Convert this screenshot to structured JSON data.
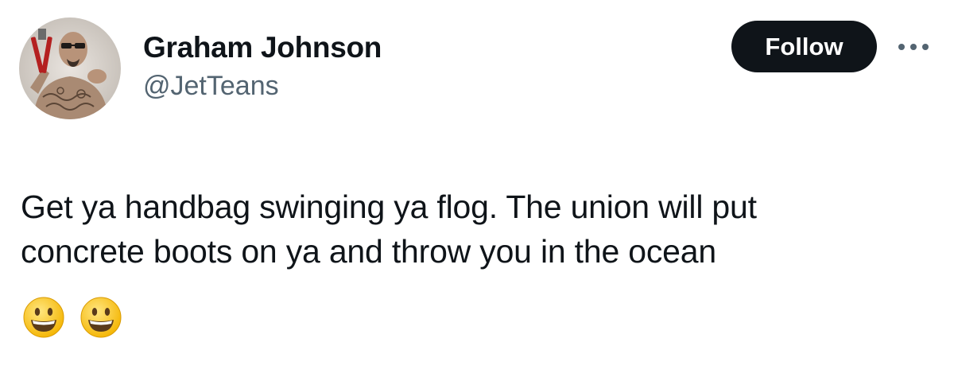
{
  "author": {
    "display_name": "Graham Johnson",
    "handle": "@JetTeans",
    "avatar_icon": "profile-photo-avatar"
  },
  "actions": {
    "follow_label": "Follow",
    "more_icon": "more-horizontal-icon"
  },
  "tweet": {
    "text_lines": [
      "Get ya handbag swinging ya flog. The union will put",
      "concrete boots on ya and throw you in the ocean"
    ],
    "emojis": [
      "grinning-face-emoji",
      "grinning-face-emoji"
    ]
  },
  "colors": {
    "text_primary": "#0f1419",
    "text_secondary": "#536471",
    "follow_bg": "#0f1419",
    "follow_text": "#ffffff",
    "background": "#ffffff"
  }
}
